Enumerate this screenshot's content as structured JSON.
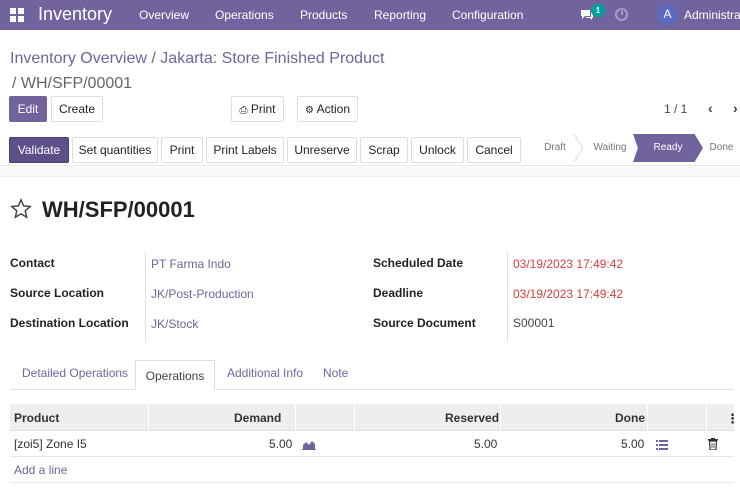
{
  "navbar": {
    "app_name": "Inventory",
    "menu": [
      "Overview",
      "Operations",
      "Products",
      "Reporting",
      "Configuration"
    ],
    "chat_badge": "1",
    "avatar_letter": "A",
    "user_name": "Administrator",
    "color": "#71639e"
  },
  "breadcrumb": {
    "parent": "Inventory Overview",
    "sep": "/",
    "middle": "Jakarta: Store Finished Product",
    "current": "/ WH/SFP/00001"
  },
  "controls": {
    "edit": "Edit",
    "create": "Create",
    "print": "Print",
    "action": "Action",
    "pager": "1 / 1"
  },
  "statusbar": {
    "buttons": [
      "Validate",
      "Set quantities",
      "Print",
      "Print Labels",
      "Unreserve",
      "Scrap",
      "Unlock",
      "Cancel"
    ],
    "stages": [
      "Draft",
      "Waiting",
      "Ready",
      "Done"
    ],
    "active_stage": "Ready"
  },
  "record": {
    "title": "WH/SFP/00001",
    "left_fields": [
      {
        "label": "Contact",
        "value": "PT Farma Indo"
      },
      {
        "label": "Source Location",
        "value": "JK/Post-Production"
      },
      {
        "label": "Destination Location",
        "value": "JK/Stock"
      }
    ],
    "right_fields": [
      {
        "label": "Scheduled Date",
        "value": "03/19/2023 17:49:42"
      },
      {
        "label": "Deadline",
        "value": "03/19/2023 17:49:42"
      },
      {
        "label": "Source Document",
        "value": "S00001"
      }
    ]
  },
  "tabs": [
    "Detailed Operations",
    "Operations",
    "Additional Info",
    "Note"
  ],
  "table": {
    "columns": [
      "Product",
      "Demand",
      "Reserved",
      "Done"
    ],
    "rows": [
      {
        "product": "[zoi5] Zone I5",
        "demand": "5.00",
        "reserved": "5.00",
        "done": "5.00"
      }
    ],
    "add_line": "Add a line"
  }
}
